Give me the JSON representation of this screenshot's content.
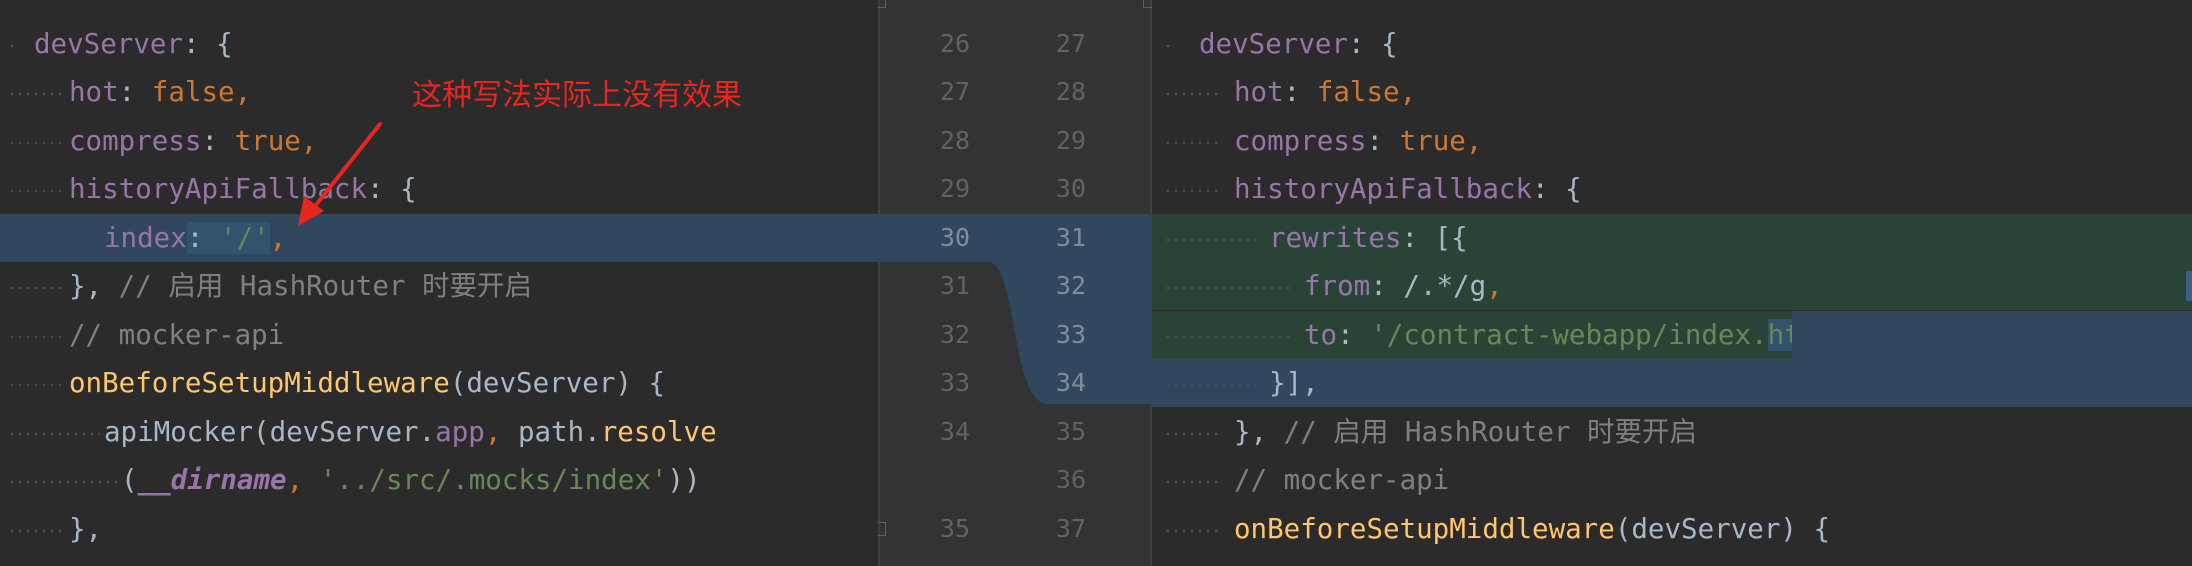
{
  "annotation": {
    "text": "这种写法实际上没有效果",
    "color": "#e8261f"
  },
  "colors": {
    "background": "#2b2b2b",
    "changed_line": "#30475e",
    "inserted_line": "#294436",
    "keyword": "#cc7832",
    "property": "#9876aa",
    "string": "#6a8759",
    "function": "#ffc66d",
    "comment": "#808080"
  },
  "gutter": {
    "left_numbers": [
      "26",
      "27",
      "28",
      "29",
      "30",
      "31",
      "32",
      "33",
      "34",
      "",
      "35"
    ],
    "right_numbers": [
      "27",
      "28",
      "29",
      "30",
      "31",
      "32",
      "33",
      "34",
      "35",
      "36",
      "37"
    ]
  },
  "left_code": {
    "l1": {
      "t1": "devServer",
      "t2": ": {"
    },
    "l2": {
      "t1": "hot",
      "t2": ": ",
      "t3": "false,"
    },
    "l3": {
      "t1": "compress",
      "t2": ": ",
      "t3": "true,"
    },
    "l4": {
      "t1": "historyApiFallback",
      "t2": ": {"
    },
    "l5": {
      "t1": "index",
      "t2": ": ",
      "t3": "'/'",
      "t4": ","
    },
    "l6": {
      "t1": "}, ",
      "t2": "// ",
      "t3": "启用",
      "t4": " HashRouter ",
      "t5": "时要开启"
    },
    "l7": {
      "t1": "// mocker-api"
    },
    "l8": {
      "t1": "onBeforeSetupMiddleware",
      "t2": "(devServer) {"
    },
    "l9": {
      "t1": "apiMocker(devServer.",
      "t2": "app",
      "t3": ", ",
      "t4": "path.",
      "t5": "resolve"
    },
    "l10": {
      "t1": "(",
      "t2": "__dirname",
      "t3": ", ",
      "t4": "'../src/.mocks/index'",
      "t5": "))"
    },
    "l11": {
      "t1": "},"
    }
  },
  "right_code": {
    "l1": {
      "t1": "devServer",
      "t2": ": {"
    },
    "l2": {
      "t1": "hot",
      "t2": ": ",
      "t3": "false,"
    },
    "l3": {
      "t1": "compress",
      "t2": ": ",
      "t3": "true,"
    },
    "l4": {
      "t1": "historyApiFallback",
      "t2": ": {"
    },
    "l5": {
      "t1": "rewrites",
      "t2": ": [{"
    },
    "l6": {
      "t1": "from",
      "t2": ": ",
      "t3": "/.*/g",
      "t4": ","
    },
    "l7": {
      "t1": "to",
      "t2": ": ",
      "t3": "'/contract-webapp/index.",
      "t4": "html'",
      "t5": ","
    },
    "l8": {
      "t1": "}],"
    },
    "l9": {
      "t1": "}, ",
      "t2": "// ",
      "t3": "启用",
      "t4": " HashRouter ",
      "t5": "时要开启"
    },
    "l10": {
      "t1": "// mocker-api"
    },
    "l11": {
      "t1": "onBeforeSetupMiddleware",
      "t2": "(devServer) {"
    }
  }
}
